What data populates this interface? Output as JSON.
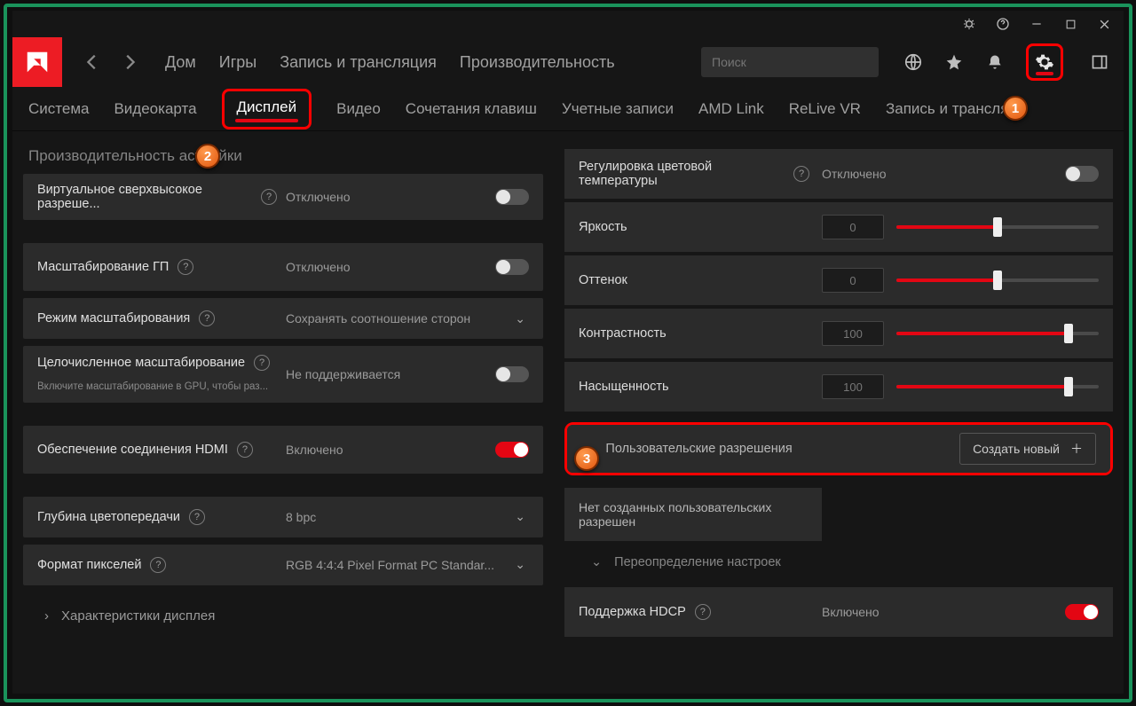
{
  "titlebar": {
    "icons": [
      "bug",
      "help",
      "minimize",
      "maximize",
      "close"
    ]
  },
  "topbar": {
    "nav": {
      "home": "Дом",
      "games": "Игры",
      "stream": "Запись и трансляция",
      "perf": "Производительность"
    },
    "searchPlaceholder": "Поиск"
  },
  "tabs": {
    "system": "Система",
    "gpu": "Видеокарта",
    "display": "Дисплей",
    "video": "Видео",
    "hotkeys": "Сочетания клавиш",
    "accounts": "Учетные записи",
    "amdlink": "AMD Link",
    "relive": "ReLive VR",
    "rec": "Запись и трансляц"
  },
  "left": {
    "section": "Производительность          астройки",
    "vsr": {
      "label": "Виртуальное сверхвысокое разреше...",
      "value": "Отключено"
    },
    "gpuScale": {
      "label": "Масштабирование ГП",
      "value": "Отключено"
    },
    "scaleMode": {
      "label": "Режим масштабирования",
      "value": "Сохранять соотношение сторон"
    },
    "intScale": {
      "label": "Целочисленное масштабирование",
      "sub": "Включите масштабирование в GPU, чтобы раз...",
      "value": "Не поддерживается"
    },
    "hdmi": {
      "label": "Обеспечение соединения HDMI",
      "value": "Включено"
    },
    "depth": {
      "label": "Глубина цветопередачи",
      "value": "8 bpc"
    },
    "pix": {
      "label": "Формат пикселей",
      "value": "RGB 4:4:4 Pixel Format PC Standar..."
    },
    "specs": "Характеристики дисплея"
  },
  "right": {
    "colortemp": {
      "label": "Регулировка цветовой температуры",
      "value": "Отключено"
    },
    "brightness": {
      "label": "Яркость",
      "num": "0",
      "pct": 50
    },
    "hue": {
      "label": "Оттенок",
      "num": "0",
      "pct": 50
    },
    "contrast": {
      "label": "Контрастность",
      "num": "100",
      "pct": 85
    },
    "saturation": {
      "label": "Насыщенность",
      "num": "100",
      "pct": 85
    },
    "custom": {
      "title": "Пользовательские разрешения",
      "new": "Создать новый",
      "empty": "Нет созданных пользовательских разрешен"
    },
    "override": "Переопределение настроек",
    "hdcp": {
      "label": "Поддержка HDCP",
      "value": "Включено"
    }
  },
  "badges": {
    "b1": "1",
    "b2": "2",
    "b3": "3"
  }
}
